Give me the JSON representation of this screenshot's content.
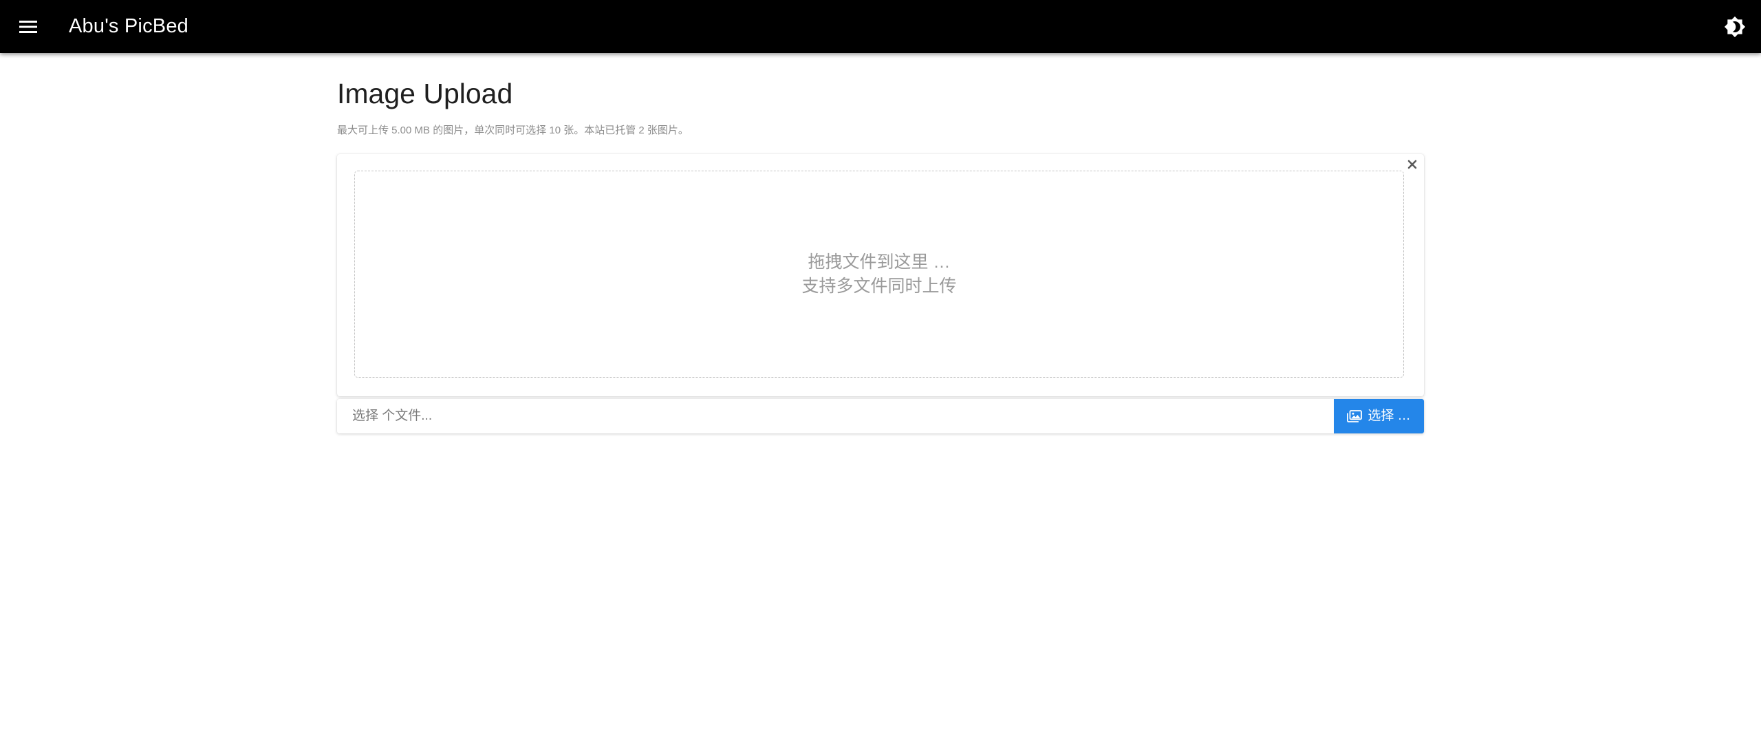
{
  "app": {
    "title": "Abu's PicBed",
    "menu_icon": "menu-icon",
    "theme_icon": "brightness-icon"
  },
  "page": {
    "title": "Image Upload",
    "subtitle": "最大可上传 5.00 MB 的图片，单次同时可选择 10 张。本站已托管 2 张图片。"
  },
  "dropzone": {
    "line1": "拖拽文件到这里 …",
    "line2": "支持多文件同时上传",
    "close_icon": "close-icon"
  },
  "file_picker": {
    "placeholder": "选择 个文件...",
    "button_label": "选择 …",
    "button_icon": "images-icon"
  },
  "colors": {
    "appbar_bg": "#000000",
    "accent": "#2486e9",
    "drop_text": "#9a9a9a",
    "subtitle_text": "#8c8c8c"
  }
}
